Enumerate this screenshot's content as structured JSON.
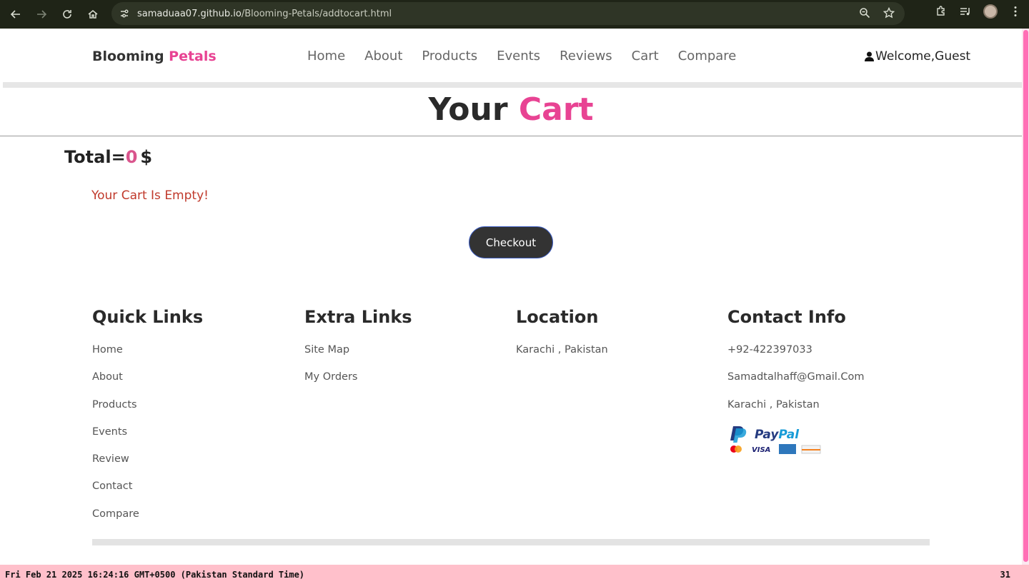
{
  "browser": {
    "url_host": "samaduaa07.github.io",
    "url_path": "/Blooming-Petals/addtocart.html"
  },
  "header": {
    "logo_main": "Blooming ",
    "logo_accent": "Petals",
    "nav": [
      "Home",
      "About",
      "Products",
      "Events",
      "Reviews",
      "Cart",
      "Compare"
    ],
    "welcome": "Welcome,Guest"
  },
  "cart": {
    "title_main": "Your ",
    "title_accent": "Cart",
    "total_label": "Total=",
    "total_value": "0",
    "currency": "$",
    "empty_message": "Your Cart Is Empty!",
    "checkout_label": "Checkout"
  },
  "footer": {
    "quick_links": {
      "title": "Quick Links",
      "items": [
        "Home",
        "About",
        "Products",
        "Events",
        "Review",
        "Contact",
        "Compare"
      ]
    },
    "extra_links": {
      "title": "Extra Links",
      "items": [
        "Site Map",
        "My Orders"
      ]
    },
    "location": {
      "title": "Location",
      "items": [
        "Karachi , Pakistan"
      ]
    },
    "contact": {
      "title": "Contact Info",
      "items": [
        "+92-422397033",
        "Samadtalhaff@Gmail.Com",
        "Karachi , Pakistan"
      ]
    },
    "payment_logo": "PayPal"
  },
  "status_bar": {
    "datetime": "Fri Feb 21 2025 16:24:16 GMT+0500 (Pakistan Standard Time)",
    "day": "31"
  },
  "colors": {
    "accent": "#e84393",
    "chrome": "#1f2417",
    "status_bar": "#ffc0cb"
  }
}
